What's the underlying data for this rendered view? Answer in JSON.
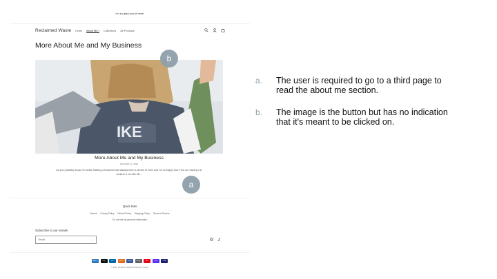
{
  "site": {
    "announcement": "I'm so glad you're here!",
    "logo": "Reclaimed Waste",
    "nav": [
      {
        "label": "Home",
        "active": false
      },
      {
        "label": "About Me:)",
        "active": true
      },
      {
        "label": "Collections",
        "active": false
      },
      {
        "label": "All Products",
        "active": false
      }
    ],
    "header_icons": [
      "search-icon",
      "account-icon",
      "cart-icon"
    ],
    "page_title": "More About Me and My Business",
    "hero_text": "IKE",
    "card": {
      "title": "More About Me and My Business",
      "date": "JANUARY 12, 2022",
      "excerpt": "As you probably know I'm Bella! Starting a business has always been a dream of mine and I'm so happy that YOU are helping me achieve it. A Little Bit..."
    },
    "footer": {
      "quick_links_title": "Quick links",
      "quick_links": [
        "Search",
        "Privacy Policy",
        "Refund Policy",
        "Shipping Policy",
        "Terms of Service"
      ],
      "do_not_sell": "Do not sell my personal information",
      "subscribe_title": "Subscribe to our emails",
      "email_placeholder": "Email",
      "email_arrow": "→",
      "social_icons": [
        "instagram-icon",
        "tiktok-icon"
      ],
      "payments": [
        {
          "name": "AMEX",
          "color": "#2e77bc"
        },
        {
          "name": "Pay",
          "color": "#111111"
        },
        {
          "name": "DC",
          "color": "#0069aa"
        },
        {
          "name": "DISC",
          "color": "#e36c1f"
        },
        {
          "name": "meta",
          "color": "#3b5998"
        },
        {
          "name": "GPay",
          "color": "#5f6368"
        },
        {
          "name": "MC",
          "color": "#eb001b"
        },
        {
          "name": "Pay",
          "color": "#5a31f4"
        },
        {
          "name": "VISA",
          "color": "#1a1f71"
        }
      ],
      "copyright": "© 2022, Reclaimed Waste Powered by Shopify"
    }
  },
  "markers": {
    "a": "a",
    "b": "b"
  },
  "notes": [
    {
      "label": "a.",
      "text": "The user is required to go to a third page to read the about me section."
    },
    {
      "label": "b.",
      "text": "The image is the button but has no indication that it's meant to be clicked on."
    }
  ],
  "colors": {
    "marker": "#8ea0ab",
    "text": "#111111"
  }
}
